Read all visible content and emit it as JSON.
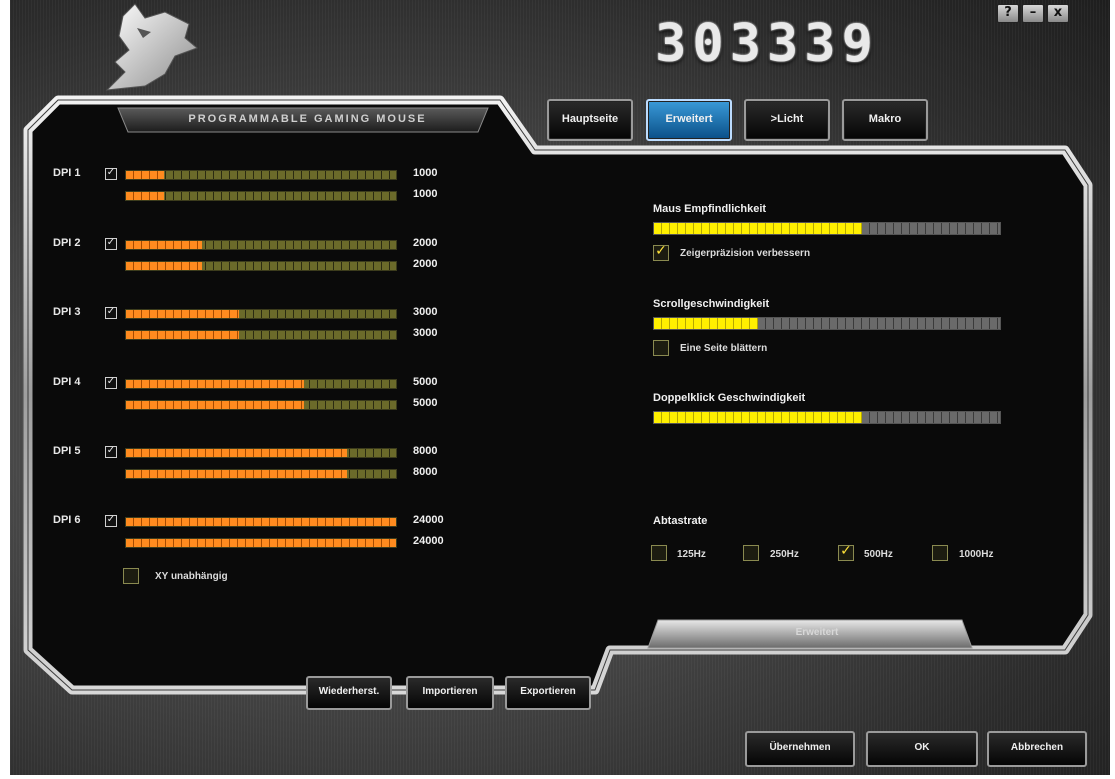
{
  "window": {
    "product_code": "303339",
    "controls": [
      "?",
      "–",
      "x"
    ]
  },
  "panel": {
    "title": "PROGRAMMABLE GAMING MOUSE",
    "subtab_label": "Erweitert"
  },
  "tabs": [
    {
      "label": "Hauptseite",
      "active": false
    },
    {
      "label": "Erweitert",
      "active": true
    },
    {
      "label": ">Licht",
      "active": false
    },
    {
      "label": "Makro",
      "active": false
    }
  ],
  "dpi": {
    "rows": [
      {
        "label": "DPI 1",
        "checked": true,
        "x_value": "1000",
        "y_value": "1000",
        "x_level": 0.14,
        "y_level": 0.14
      },
      {
        "label": "DPI 2",
        "checked": true,
        "x_value": "2000",
        "y_value": "2000",
        "x_level": 0.28,
        "y_level": 0.28
      },
      {
        "label": "DPI 3",
        "checked": true,
        "x_value": "3000",
        "y_value": "3000",
        "x_level": 0.42,
        "y_level": 0.42
      },
      {
        "label": "DPI 4",
        "checked": true,
        "x_value": "5000",
        "y_value": "5000",
        "x_level": 0.66,
        "y_level": 0.66
      },
      {
        "label": "DPI 5",
        "checked": true,
        "x_value": "8000",
        "y_value": "8000",
        "x_level": 0.82,
        "y_level": 0.82
      },
      {
        "label": "DPI 6",
        "checked": true,
        "x_value": "24000",
        "y_value": "24000",
        "x_level": 1.0,
        "y_level": 1.0
      }
    ],
    "xy_independent": {
      "label": "XY unabhängig",
      "checked": false
    }
  },
  "settings": {
    "sensitivity": {
      "label": "Maus Empfindlichkeit",
      "level": 0.6
    },
    "pointer_precision": {
      "label": "Zeigerpräzision verbessern",
      "checked": true
    },
    "scroll_speed": {
      "label": "Scrollgeschwindigkeit",
      "level": 0.3
    },
    "scroll_page": {
      "label": "Eine Seite blättern",
      "checked": false
    },
    "double_click": {
      "label": "Doppelklick Geschwindigkeit",
      "level": 0.6
    }
  },
  "polling": {
    "label": "Abtastrate",
    "options": [
      {
        "label": "125Hz",
        "checked": false
      },
      {
        "label": "250Hz",
        "checked": false
      },
      {
        "label": "500Hz",
        "checked": true
      },
      {
        "label": "1000Hz",
        "checked": false
      }
    ]
  },
  "panel_buttons": {
    "restore": "Wiederherst.",
    "import": "Importieren",
    "export": "Exportieren"
  },
  "footer": {
    "apply": "Übernehmen",
    "ok": "OK",
    "cancel": "Abbrechen"
  },
  "colors": {
    "dpi_fill": "#ff8b1f",
    "dpi_track": "#6b6a2a",
    "slider_fill": "#fff000",
    "active_tab": "#1c78c0",
    "checkmark": "#ffe23a"
  }
}
